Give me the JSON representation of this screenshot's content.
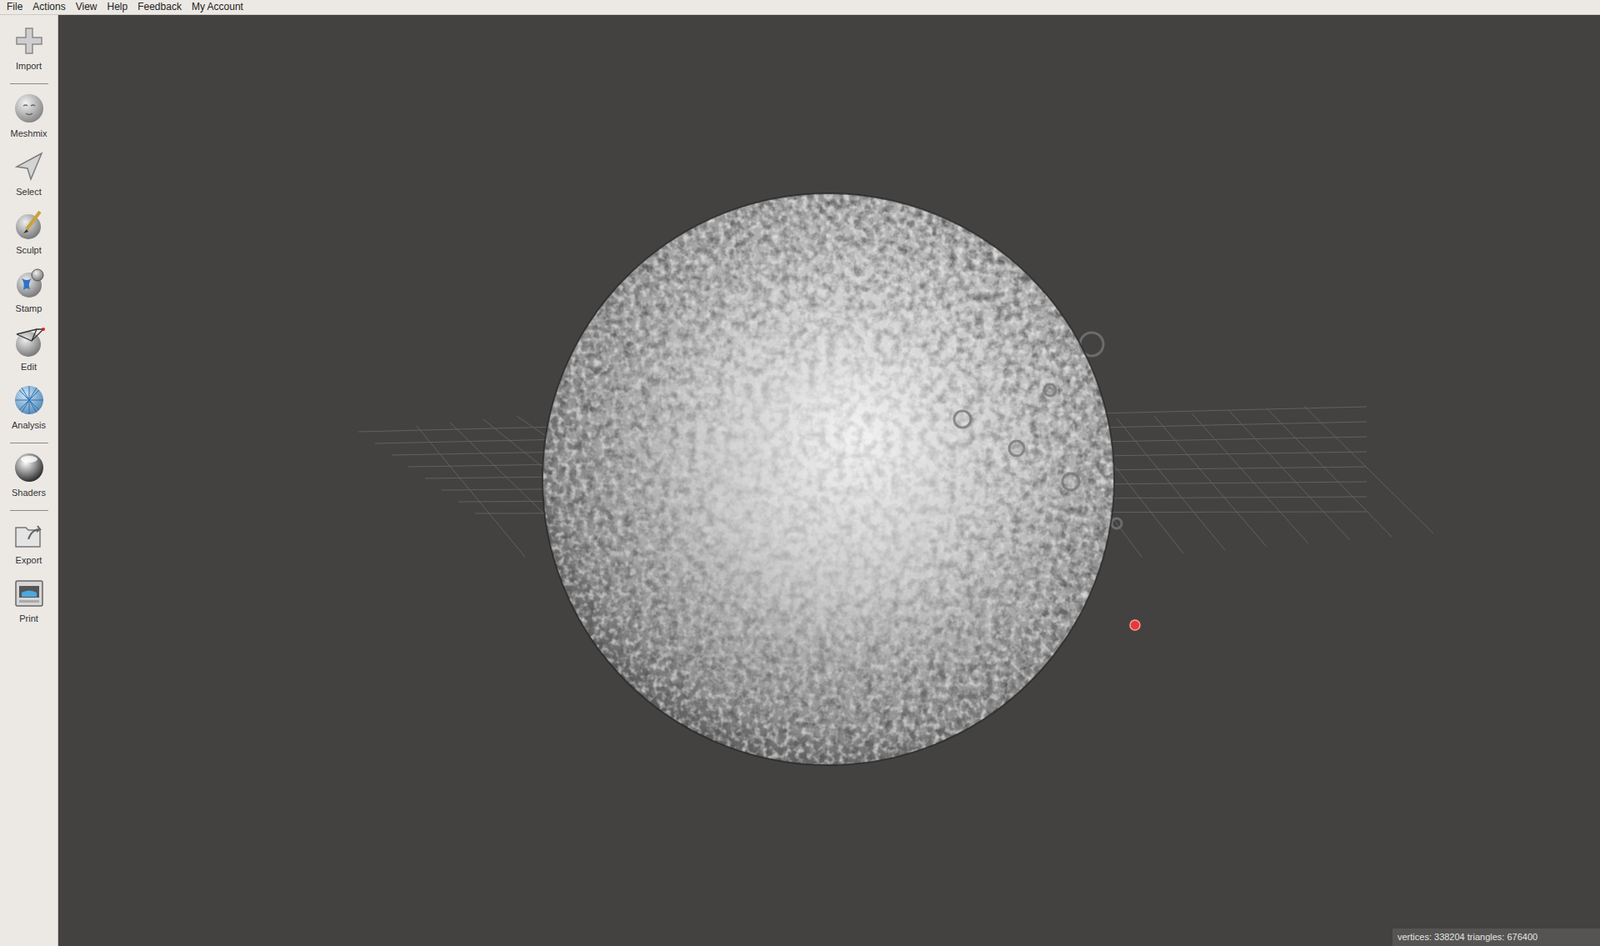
{
  "menu": [
    "File",
    "Actions",
    "View",
    "Help",
    "Feedback",
    "My Account"
  ],
  "toolbar": {
    "groups": [
      {
        "tools": [
          {
            "label": "Import"
          }
        ]
      },
      {
        "tools": [
          {
            "label": "Meshmix"
          },
          {
            "label": "Select"
          },
          {
            "label": "Sculpt"
          },
          {
            "label": "Stamp"
          },
          {
            "label": "Edit"
          },
          {
            "label": "Analysis"
          }
        ]
      },
      {
        "tools": [
          {
            "label": "Shaders"
          }
        ]
      },
      {
        "tools": [
          {
            "label": "Export"
          },
          {
            "label": "Print"
          }
        ]
      }
    ]
  },
  "status_bar": "vertices: 338204 triangles: 676400"
}
